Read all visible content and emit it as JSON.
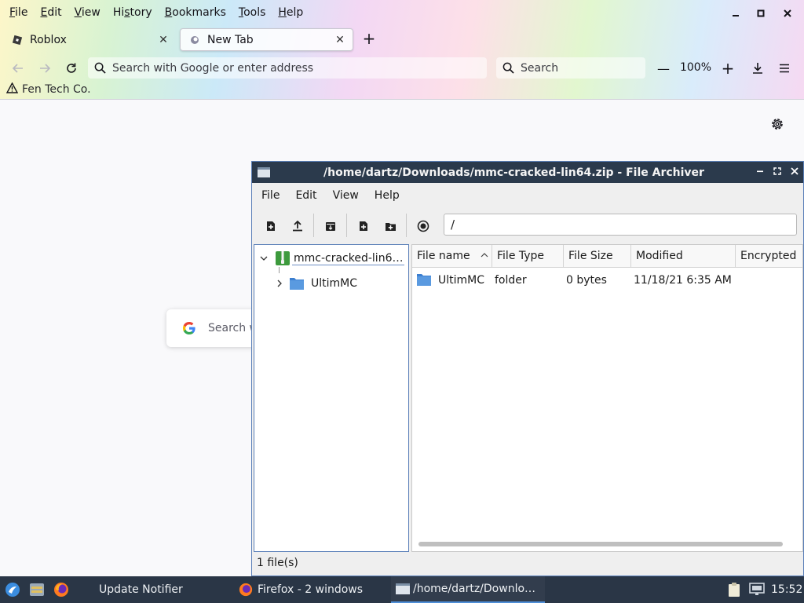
{
  "firefox": {
    "menu": [
      "File",
      "Edit",
      "View",
      "History",
      "Bookmarks",
      "Tools",
      "Help"
    ],
    "menu_access_keys": [
      "F",
      "E",
      "V",
      "s",
      "B",
      "T",
      "H"
    ],
    "tabs": [
      {
        "label": "Roblox",
        "active": false
      },
      {
        "label": "New Tab",
        "active": true
      }
    ],
    "new_tab_symbol": "+",
    "address_placeholder": "Search with Google or enter address",
    "search_placeholder": "Search",
    "zoom": "100%",
    "zoom_out": "—",
    "zoom_in": "+",
    "bookmark": "Fen Tech Co.",
    "content_search_placeholder": "Search w"
  },
  "archiver": {
    "title": "/home/dartz/Downloads/mmc-cracked-lin64.zip - File Archiver",
    "menu": [
      "File",
      "Edit",
      "View",
      "Help"
    ],
    "path": "/",
    "tree": {
      "root": "mmc-cracked-lin6…",
      "child": "UltimMC"
    },
    "columns": [
      "File name",
      "File Type",
      "File Size",
      "Modified",
      "Encrypted"
    ],
    "rows": [
      {
        "name": "UltimMC",
        "type": "folder",
        "size": "0 bytes",
        "modified": "11/18/21 6:35 AM",
        "encrypted": ""
      }
    ],
    "status": "1 file(s)"
  },
  "taskbar": {
    "items": [
      {
        "label": "Update Notifier",
        "active": false
      },
      {
        "label": "Firefox - 2 windows",
        "active": false
      },
      {
        "label": "/home/dartz/Downlo…",
        "active": true
      }
    ],
    "clock": "15:52"
  },
  "colors": {
    "taskbar_bg": "#2a3646",
    "archiver_title_bg": "#2b3a4c",
    "folder_blue": "#4a90d9",
    "accent": "#4f8fd8"
  }
}
